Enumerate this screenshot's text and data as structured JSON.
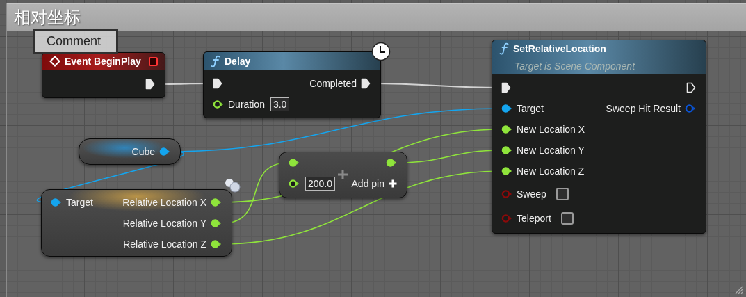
{
  "comment": {
    "title": "相对坐标"
  },
  "comment_bubble": {
    "text": "Comment"
  },
  "nodes": [
    {
      "kind": "event",
      "title": "Event BeginPlay",
      "outputs": [
        {
          "kind": "exec",
          "connected": true
        }
      ]
    },
    {
      "kind": "function",
      "title": "Delay",
      "latent": true,
      "inputs": [
        {
          "kind": "exec",
          "connected": true
        },
        {
          "kind": "float",
          "label": "Duration",
          "connected": false,
          "value": "3.0"
        }
      ],
      "outputs": [
        {
          "kind": "exec",
          "label": "Completed",
          "connected": true
        }
      ]
    },
    {
      "kind": "function",
      "title": "SetRelativeLocation",
      "subtitle": "Target is Scene Component",
      "latent": false,
      "inputs": [
        {
          "kind": "exec",
          "connected": true
        },
        {
          "kind": "object",
          "label": "Target",
          "connected": true
        },
        {
          "kind": "float",
          "label": "New Location X",
          "connected": true
        },
        {
          "kind": "float",
          "label": "New Location Y",
          "connected": true
        },
        {
          "kind": "float",
          "label": "New Location Z",
          "connected": true
        },
        {
          "kind": "bool",
          "label": "Sweep",
          "connected": false,
          "checked": false
        },
        {
          "kind": "bool",
          "label": "Teleport",
          "connected": false,
          "checked": false
        }
      ],
      "outputs": [
        {
          "kind": "exec",
          "connected": false
        },
        {
          "kind": "struct",
          "label": "Sweep Hit Result",
          "connected": false
        }
      ]
    },
    {
      "kind": "variable",
      "outputs": [
        {
          "kind": "object",
          "label": "Cube",
          "connected": true
        }
      ]
    },
    {
      "kind": "math",
      "inputs": [
        {
          "kind": "float",
          "connected": true
        },
        {
          "kind": "float",
          "connected": false,
          "value": "200.0"
        }
      ],
      "outputs": [
        {
          "kind": "float",
          "connected": true
        }
      ],
      "add_pin": "Add pin"
    },
    {
      "kind": "break",
      "inputs": [
        {
          "kind": "object",
          "label": "Target",
          "connected": true
        }
      ],
      "outputs": [
        {
          "kind": "float",
          "label": "Relative Location X",
          "connected": true
        },
        {
          "kind": "float",
          "label": "Relative Location Y",
          "connected": true
        },
        {
          "kind": "float",
          "label": "Relative Location Z",
          "connected": true
        }
      ]
    }
  ]
}
